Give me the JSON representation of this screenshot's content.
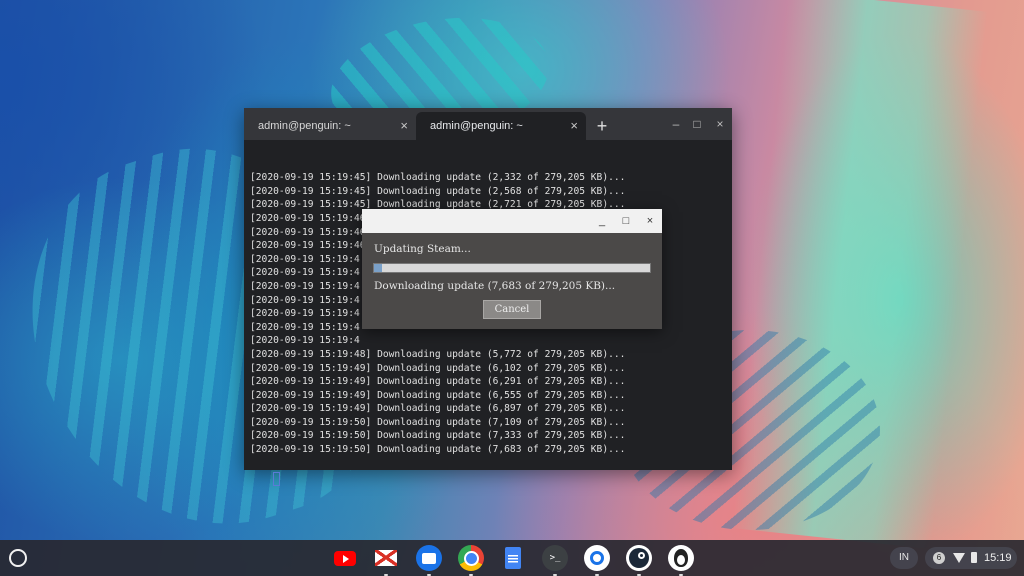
{
  "terminal": {
    "tabs": [
      {
        "label": "admin@penguin: ~",
        "close": "×"
      },
      {
        "label": "admin@penguin: ~",
        "close": "×"
      }
    ],
    "new_tab": "+",
    "window_controls": {
      "minimize": "–",
      "maximize": "□",
      "close": "×"
    },
    "lines": [
      "[2020-09-19 15:19:45] Downloading update (2,332 of 279,205 KB)...",
      "[2020-09-19 15:19:45] Downloading update (2,568 of 279,205 KB)...",
      "[2020-09-19 15:19:45] Downloading update (2,721 of 279,205 KB)...",
      "[2020-09-19 15:19:46] Downloading update (2,948 of 279,205 KB)...",
      "[2020-09-19 15:19:46] Downloading update (3,162 of 279,205 KB)...",
      "[2020-09-19 15:19:46",
      "[2020-09-19 15:19:4",
      "[2020-09-19 15:19:4",
      "[2020-09-19 15:19:4",
      "[2020-09-19 15:19:4",
      "[2020-09-19 15:19:4",
      "[2020-09-19 15:19:4",
      "[2020-09-19 15:19:4",
      "[2020-09-19 15:19:48] Downloading update (5,772 of 279,205 KB)...",
      "[2020-09-19 15:19:49] Downloading update (6,102 of 279,205 KB)...",
      "[2020-09-19 15:19:49] Downloading update (6,291 of 279,205 KB)...",
      "[2020-09-19 15:19:49] Downloading update (6,555 of 279,205 KB)...",
      "[2020-09-19 15:19:49] Downloading update (6,897 of 279,205 KB)...",
      "[2020-09-19 15:19:50] Downloading update (7,109 of 279,205 KB)...",
      "[2020-09-19 15:19:50] Downloading update (7,333 of 279,205 KB)...",
      "[2020-09-19 15:19:50] Downloading update (7,683 of 279,205 KB)..."
    ]
  },
  "dialog": {
    "controls": {
      "minimize": "_",
      "maximize": "□",
      "close": "×"
    },
    "title_text": "Updating Steam...",
    "status_text": "Downloading update (7,683 of 279,205 KB)...",
    "progress_fraction": 0.0275,
    "cancel_label": "Cancel"
  },
  "shelf": {
    "apps": [
      {
        "name": "youtube-icon"
      },
      {
        "name": "gmail-icon"
      },
      {
        "name": "files-icon"
      },
      {
        "name": "chrome-icon"
      },
      {
        "name": "docs-icon"
      },
      {
        "name": "terminal-icon",
        "glyph": ">_"
      },
      {
        "name": "chrome-unboxed-icon"
      },
      {
        "name": "steam-icon"
      },
      {
        "name": "penguin-icon"
      }
    ],
    "ime": "IN",
    "notification_count": "6",
    "time": "15:19"
  }
}
